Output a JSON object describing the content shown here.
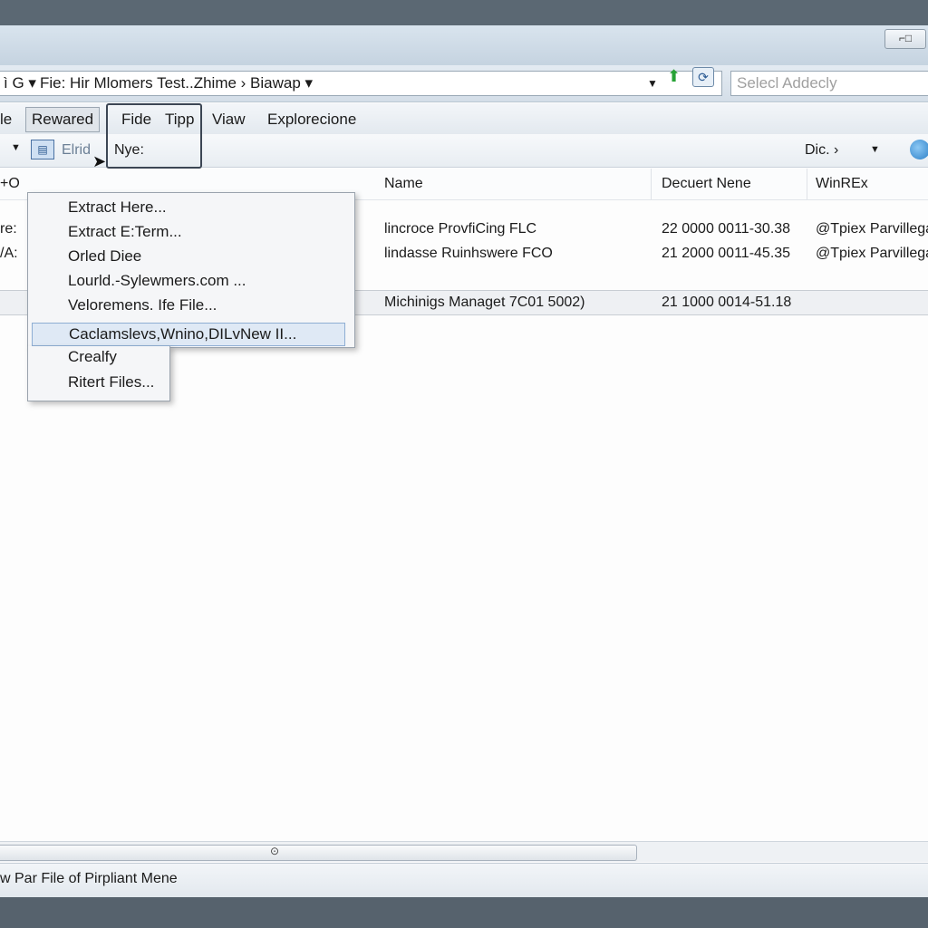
{
  "window": {
    "control_label": "⌐□"
  },
  "address": {
    "prefix": "ì G ▾",
    "path": "Fie: Hir Mlomers Test..Zhime › Biawap ▾",
    "dropdown_arrow": "▼",
    "search_placeholder": "Selecl Addecly"
  },
  "menu": {
    "file_fragment": "le",
    "reward": "Rewared",
    "fide": "Fide",
    "tipp": "Tipp",
    "view": "Viaw",
    "explore": "Explorecione"
  },
  "toolbar": {
    "left_arrow": "▼",
    "btn1_label": "Elrid",
    "btn2_label": "Nye:",
    "right_label": "Dic. ›",
    "right_arrow": "▼"
  },
  "columns": {
    "left_fragment": "+O",
    "name": "Name",
    "document_name": "Decuert Nene",
    "winrar": "WinREx"
  },
  "rows": [
    {
      "left": "re:",
      "name": "lincroce ProvfiCing FLC",
      "date": "22 0000 0011-30.38",
      "type": "@Tpiex Parvillega"
    },
    {
      "left": "/A:",
      "name": "lindasse Ruinhswere FCO",
      "date": "21 2000 0011-45.35",
      "type": "@Tpiex Parvillega"
    },
    {
      "left": "",
      "name": "Michinigs Managet 7C01 5002)",
      "date": "21 1000 0014-51.18",
      "type": ""
    }
  ],
  "context_menu": {
    "items": [
      "Extract Here...",
      "Extract E:Term...",
      "Orled Diee",
      "Lourld.-Sylewmers.com ...",
      "Veloremens. Ife File...",
      "Caclamslevs,Wnino,DILvNew II...",
      "Crealfy",
      "Ritert Files..."
    ],
    "highlighted_index": 5
  },
  "status": {
    "text": "w Par File of Pirpliant Mene"
  },
  "colors": {
    "selection": "#dfe9f5",
    "accent": "#2b7fc7",
    "go_arrow": "#27a236"
  },
  "icons": [
    "go-arrow-icon",
    "refresh-icon",
    "save-icon",
    "cursor-icon",
    "globe-icon"
  ]
}
